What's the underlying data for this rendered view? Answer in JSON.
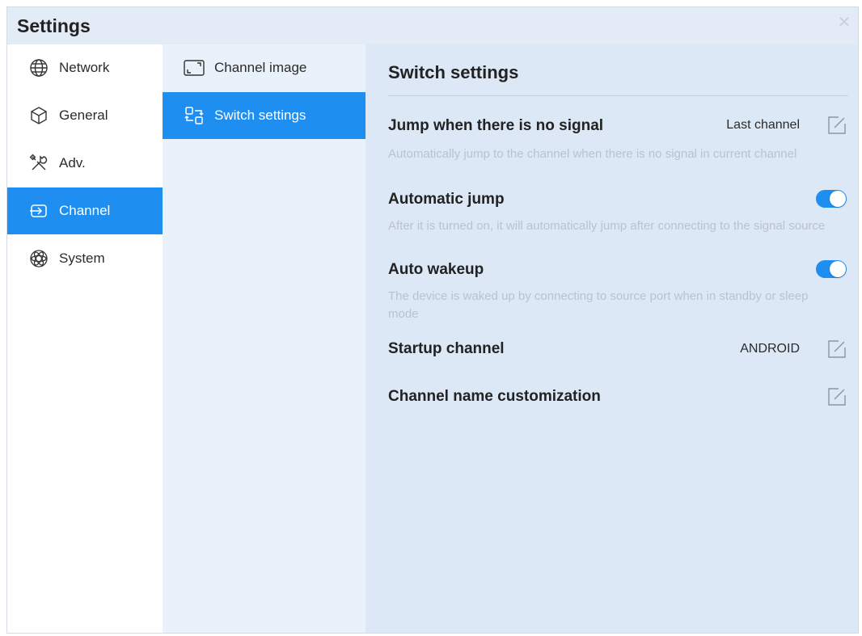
{
  "window": {
    "title": "Settings"
  },
  "sidebar": {
    "items": [
      {
        "label": "Network",
        "icon": "globe-icon"
      },
      {
        "label": "General",
        "icon": "cube-icon"
      },
      {
        "label": "Adv.",
        "icon": "tools-icon"
      },
      {
        "label": "Channel",
        "icon": "channel-icon",
        "active": true
      },
      {
        "label": "System",
        "icon": "atom-icon"
      }
    ]
  },
  "subnav": {
    "items": [
      {
        "label": "Channel image",
        "icon": "frame-icon"
      },
      {
        "label": "Switch settings",
        "icon": "switch-icon",
        "active": true
      }
    ]
  },
  "main": {
    "title": "Switch settings",
    "rows": [
      {
        "title": "Jump when there is no signal",
        "desc": "Automatically jump to the channel when there is no signal in current channel",
        "value": "Last channel",
        "control": "edit"
      },
      {
        "title": "Automatic jump",
        "desc": "After it is turned on, it will automatically jump after connecting to the signal source",
        "control": "toggle",
        "state": true
      },
      {
        "title": "Auto wakeup",
        "desc": "The device is waked up by connecting to source port when in standby or sleep mode",
        "control": "toggle",
        "state": true
      },
      {
        "title": "Startup channel",
        "value": "ANDROID",
        "control": "edit"
      },
      {
        "title": "Channel name customization",
        "control": "edit"
      }
    ]
  },
  "colors": {
    "accent": "#1e8ff0",
    "panel": "#dde8f6",
    "subpanel": "#e9f1fb"
  }
}
